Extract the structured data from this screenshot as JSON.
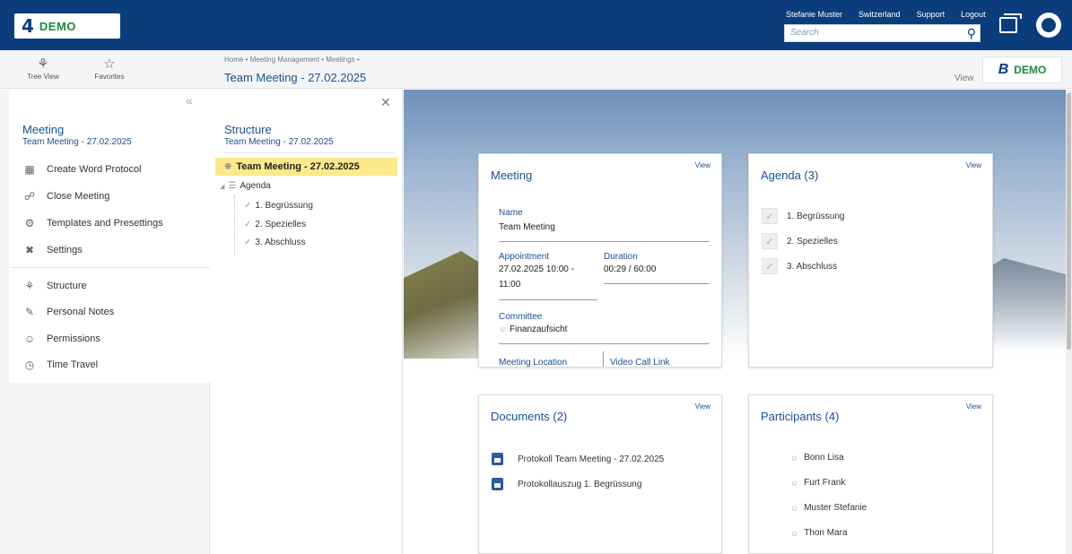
{
  "topbar": {
    "logo_mark": "4",
    "logo_text": "DEMO",
    "user_name": "Stefanie Muster",
    "country": "Switzerland",
    "support": "Support",
    "logout": "Logout",
    "search_placeholder": "Search"
  },
  "subbar": {
    "tree_view": "Tree View",
    "favorites": "Favorites",
    "breadcrumb": "Home  •  Meeting Management  •  Meetings  •",
    "page_title": "Team Meeting - 27.02.2025",
    "view": "View",
    "brand_mark": "B",
    "brand_text": "DEMO"
  },
  "leftnav": {
    "title": "Meeting",
    "subtitle": "Team Meeting - 27.02.2025",
    "collapse": "«",
    "items": [
      {
        "label": "Create Word Protocol",
        "icon": "word-doc-icon"
      },
      {
        "label": "Close Meeting",
        "icon": "lock-icon"
      },
      {
        "label": "Templates and Presettings",
        "icon": "gear-icon"
      },
      {
        "label": "Settings",
        "icon": "tools-icon"
      },
      {
        "label": "Structure",
        "icon": "structure-icon"
      },
      {
        "label": "Personal Notes",
        "icon": "notes-icon"
      },
      {
        "label": "Permissions",
        "icon": "people-icon"
      },
      {
        "label": "Time Travel",
        "icon": "clock-icon"
      }
    ]
  },
  "structure": {
    "title": "Structure",
    "subtitle": "Team Meeting - 27.02.2025",
    "root": "Team Meeting - 27.02.2025",
    "agenda": "Agenda",
    "items": [
      "1. Begrüssung",
      "2. Spezielles",
      "3. Abschluss"
    ]
  },
  "meeting_card": {
    "title": "Meeting",
    "view": "View",
    "name_label": "Name",
    "name_value": "Team Meeting",
    "appointment_label": "Appointment",
    "appointment_value": "27.02.2025 10:00 - 11:00",
    "duration_label": "Duration",
    "duration_value": "00:29 / 60:00",
    "committee_label": "Committee",
    "committee_value": "Finanzaufsicht",
    "location_label": "Meeting Location",
    "video_label": "Video Call Link"
  },
  "agenda_card": {
    "title": "Agenda (3)",
    "view": "View",
    "items": [
      "1. Begrüssung",
      "2. Spezielles",
      "3. Abschluss"
    ]
  },
  "documents_card": {
    "title": "Documents (2)",
    "view": "View",
    "items": [
      "Protokoll Team Meeting - 27.02.2025",
      "Protokollauszug 1. Begrüssung"
    ]
  },
  "participants_card": {
    "title": "Participants (4)",
    "view": "View",
    "items": [
      "Bonn Lisa",
      "Furt Frank",
      "Muster Stefanie",
      "Thon Mara"
    ]
  },
  "colors": {
    "topbar": "#0b3d7c",
    "accent": "#1a4f8f",
    "brand_green": "#1c8a3a",
    "selected": "#fbe98c"
  }
}
